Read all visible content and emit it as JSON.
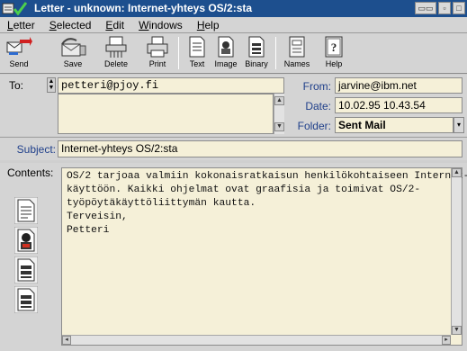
{
  "window": {
    "title": "Letter - unknown: Internet-yhteys OS/2:sta"
  },
  "menu": [
    "Letter",
    "Selected",
    "Edit",
    "Windows",
    "Help"
  ],
  "toolbar": {
    "send": "Send",
    "save": "Save",
    "delete": "Delete",
    "print": "Print",
    "text": "Text",
    "image": "Image",
    "binary": "Binary",
    "names": "Names",
    "help": "Help"
  },
  "header": {
    "to_label": "To:",
    "to_value": "petteri@pjoy.fi",
    "from_label": "From:",
    "from_value": "jarvine@ibm.net",
    "date_label": "Date:",
    "date_value": "10.02.95 10.43.54",
    "folder_label": "Folder:",
    "folder_value": "Sent Mail",
    "subject_label": "Subject:",
    "subject_value": "Internet-yhteys OS/2:sta",
    "contents_label": "Contents:"
  },
  "body_lines": [
    "OS/2 tarjoaa valmiin kokonaisratkaisun henkilökohtaiseen Internet-",
    "käyttöön. Kaikki ohjelmat ovat graafisia ja toimivat OS/2-",
    "työpöytäkäyttöliittymän kautta.",
    "",
    "Terveisin,",
    "",
    "",
    "Petteri"
  ],
  "colors": {
    "titlebar": "#1d4f8e",
    "field_bg": "#f5f0d8",
    "label_blue": "#1f3f8a"
  },
  "icons": {
    "attachments": [
      "text-document-icon",
      "image-document-icon",
      "binary-document-icon",
      "binary-document-icon"
    ]
  }
}
